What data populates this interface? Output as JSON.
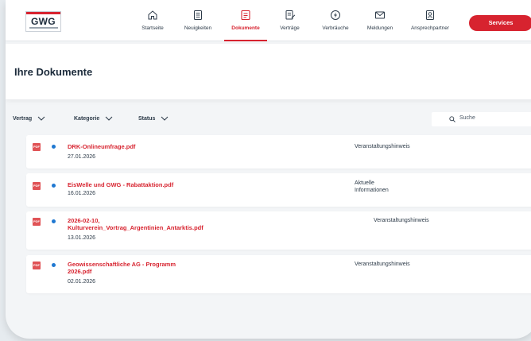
{
  "brand": {
    "logo_text": "GWG",
    "accent_color": "#d7232f",
    "unread_dot_color": "#1f78d1"
  },
  "nav": {
    "items": [
      {
        "label": "Startseite",
        "icon": "home-icon"
      },
      {
        "label": "Neuigkeiten",
        "icon": "news-icon"
      },
      {
        "label": "Dokumente",
        "icon": "document-icon",
        "active": true
      },
      {
        "label": "Verträge",
        "icon": "contract-icon"
      },
      {
        "label": "Verbräuche",
        "icon": "energy-icon"
      },
      {
        "label": "Meldungen",
        "icon": "mail-icon"
      },
      {
        "label": "Ansprechpartner",
        "icon": "contact-icon"
      }
    ],
    "services_label": "Services"
  },
  "page": {
    "title": "Ihre Dokumente"
  },
  "filters": {
    "items": [
      {
        "label": "Vertrag"
      },
      {
        "label": "Kategorie"
      },
      {
        "label": "Status"
      }
    ],
    "search_placeholder": "Suche"
  },
  "documents": [
    {
      "badge": "PDF",
      "title": "DRK-Onlineumfrage.pdf",
      "date": "27.01.2026",
      "category": "Veranstaltungshinweis",
      "unread": true
    },
    {
      "badge": "PDF",
      "title": "EisWelle und GWG - Rabattaktion.pdf",
      "date": "16.01.2026",
      "category": "Aktuelle Informationen",
      "unread": true
    },
    {
      "badge": "PDF",
      "title": "2026-02-10, Kulturverein_Vortrag_Argentinien_Antarktis.pdf",
      "date": "13.01.2026",
      "category": "Veranstaltungshinweis",
      "unread": true
    },
    {
      "badge": "PDF",
      "title": "Geowissenschaftliche AG - Programm 2026.pdf",
      "date": "02.01.2026",
      "category": "Veranstaltungshinweis",
      "unread": true
    }
  ]
}
